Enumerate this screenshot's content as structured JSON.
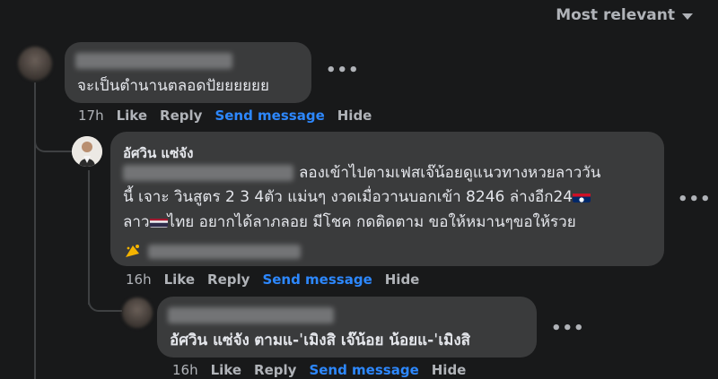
{
  "sort": {
    "label": "Most relevant"
  },
  "comment1": {
    "text": "จะเป็นตำนานตลอดปัยยยยยย",
    "time": "17h",
    "like": "Like",
    "reply": "Reply",
    "send": "Send message",
    "hide": "Hide"
  },
  "reply1": {
    "author": "อัศวิน แซ่จัง",
    "line1": "ลองเข้าไปตามเฟสเจ๊น้อยดูแนวทางหวยลาววัน",
    "line2a": "นี้ เจาะ วินสูตร 2 3 4ตัว แม่นๆ งวดเมื่อวานบอกเข้า 8246 ล่างอีก24",
    "line3a": "ลาว",
    "line3b": "ไทย อยากได้ลาภลอย มีโชค กดติดตาม ขอให้หมานๆขอให้รวย",
    "time": "16h",
    "like": "Like",
    "reply": "Reply",
    "send": "Send message",
    "hide": "Hide"
  },
  "reply2": {
    "author": "อัศวิน แซ่จัง",
    "text": "ตามแ-ˈเมิงสิ เจ๊น้อย น้อยแ-ˈเมิงสิ",
    "time": "16h",
    "like": "Like",
    "reply": "Reply",
    "send": "Send message",
    "hide": "Hide"
  },
  "icons": {
    "sort_caret": "caret-down-icon",
    "more": "more-options-icon",
    "lao_flag": "lao-flag-icon",
    "thai_flag": "thai-flag-icon",
    "emoji": "sparkle-emoji-icon"
  },
  "colors": {
    "background": "#18191a",
    "bubble": "#3a3b3c",
    "link": "#2d88ff",
    "muted": "#b0b3b8"
  }
}
